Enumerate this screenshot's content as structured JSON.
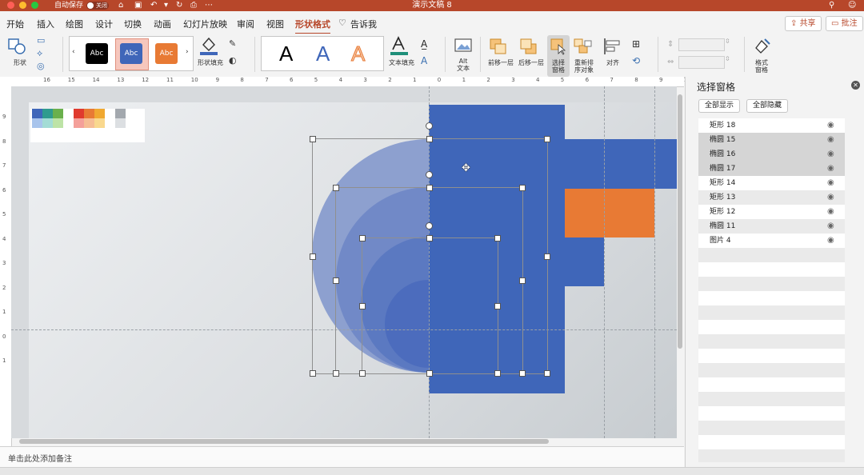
{
  "window": {
    "title": "演示文稿 8",
    "autosave_label": "自动保存",
    "autosave_state": "关闭",
    "traffic_colors": [
      "#ff5f57",
      "#febc2e",
      "#28c840"
    ]
  },
  "tabs": [
    {
      "label": "开始"
    },
    {
      "label": "插入"
    },
    {
      "label": "绘图"
    },
    {
      "label": "设计"
    },
    {
      "label": "切换"
    },
    {
      "label": "动画"
    },
    {
      "label": "幻灯片放映"
    },
    {
      "label": "审阅"
    },
    {
      "label": "视图"
    },
    {
      "label": "形状格式",
      "active": true
    },
    {
      "label": "告诉我"
    }
  ],
  "header_buttons": {
    "share": "共享",
    "comment": "批注"
  },
  "ribbon": {
    "shape_label": "形状",
    "style_samples": [
      {
        "text": "Abc",
        "color": "#000000"
      },
      {
        "text": "Abc",
        "color": "#3f66b9"
      },
      {
        "text": "Abc",
        "color": "#e87a34"
      }
    ],
    "shape_fill_label": "形状填充",
    "wordart_samples": [
      "A",
      "A",
      "A"
    ],
    "text_fill_label": "文本填充",
    "alt_text_label_1": "Alt",
    "alt_text_label_2": "文本",
    "bring_forward": "前移一层",
    "send_backward": "后移一层",
    "selection_pane_1": "选择",
    "selection_pane_2": "窗格",
    "reorder_1": "重新排",
    "reorder_2": "序对象",
    "align": "对齐",
    "format_pane_1": "格式",
    "format_pane_2": "窗格"
  },
  "ruler": {
    "labels": [
      "16",
      "15",
      "14",
      "13",
      "12",
      "11",
      "10",
      "9",
      "8",
      "7",
      "6",
      "5",
      "4",
      "3",
      "2",
      "1",
      "0",
      "1",
      "2",
      "3",
      "4",
      "5",
      "6",
      "7",
      "8",
      "9",
      "10"
    ]
  },
  "vertical_ruler": {
    "labels": [
      "9",
      "8",
      "7",
      "6",
      "5",
      "4",
      "3",
      "2",
      "1",
      "0",
      "1"
    ]
  },
  "notes": {
    "placeholder": "单击此处添加备注"
  },
  "colors": {
    "accent": "#b7472a",
    "shape_blue": "#3f66b9",
    "shape_orange": "#e87a34",
    "circle_1": "#8da0cf",
    "circle_2": "#7189c7",
    "circle_3": "#5b79c1"
  },
  "selection_pane": {
    "title": "选择窗格",
    "show_all": "全部显示",
    "hide_all": "全部隐藏",
    "items": [
      {
        "name": "矩形 18",
        "selected": false
      },
      {
        "name": "椭圆 15",
        "selected": true
      },
      {
        "name": "椭圆 16",
        "selected": true
      },
      {
        "name": "椭圆 17",
        "selected": true
      },
      {
        "name": "矩形 14",
        "selected": false
      },
      {
        "name": "矩形 13",
        "selected": false
      },
      {
        "name": "矩形 12",
        "selected": false
      },
      {
        "name": "椭圆 11",
        "selected": false
      },
      {
        "name": "图片 4",
        "selected": false
      }
    ]
  }
}
